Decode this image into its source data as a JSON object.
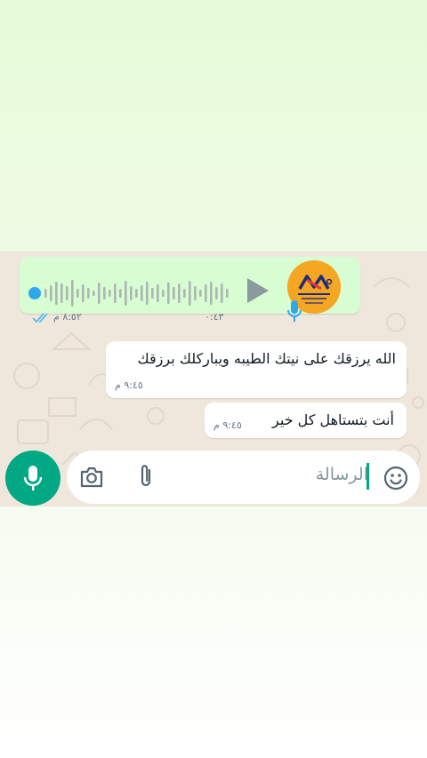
{
  "voice_message": {
    "duration": "٠:٤٣",
    "time": "٨:٥٢ م",
    "avatar_icon": "logo-avatar",
    "play_icon": "play-icon",
    "mic_icon": "mic-icon",
    "status_icon": "double-check-icon",
    "status_color": "#53bdeb"
  },
  "messages": [
    {
      "text": "الله يرزقك على نيتك الطيبه ويباركلك برزقك",
      "time": "٩:٤٥ م"
    },
    {
      "text": "أنت بتستاهل كل خير",
      "time": "٩:٤٥ م"
    }
  ],
  "input": {
    "placeholder": "الرسالة",
    "camera_icon": "camera-icon",
    "attach_icon": "paperclip-icon",
    "emoji_icon": "emoji-icon",
    "mic_button_icon": "mic-icon",
    "accent_color": "#00a884"
  }
}
